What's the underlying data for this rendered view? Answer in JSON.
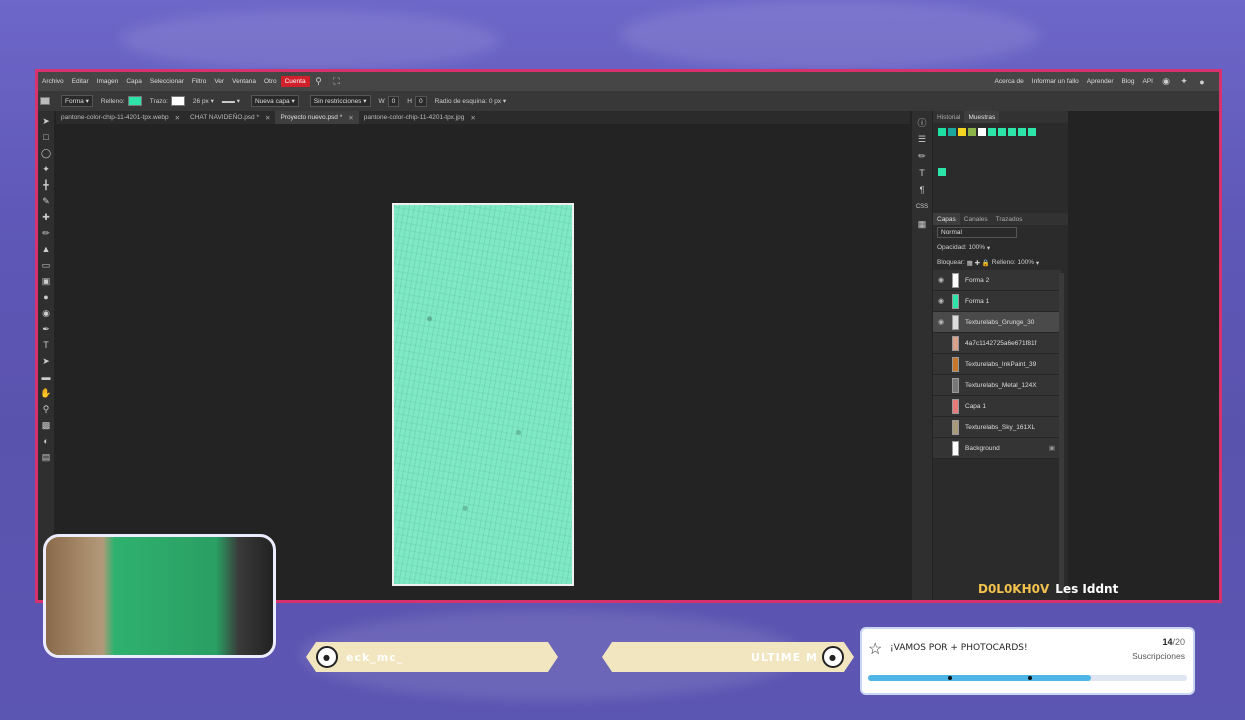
{
  "menubar": {
    "items": [
      "Archivo",
      "Editar",
      "Imagen",
      "Capa",
      "Seleccionar",
      "Filtro",
      "Ver",
      "Ventana",
      "Otro",
      "Cuenta"
    ],
    "right_links": [
      "Acerca de",
      "Informar un fallo",
      "Aprender",
      "Blog",
      "API"
    ]
  },
  "options": {
    "shape_mode": "Forma",
    "fill_label": "Relleno:",
    "fill_color": "#2de5a8",
    "stroke_label": "Trazo:",
    "stroke_size": "26 px",
    "layer_mode": "Nueva capa",
    "constraint": "Sin restricciones",
    "w": "0",
    "h": "0",
    "radius_label": "Radio de esquina:",
    "radius_value": "0 px"
  },
  "tabs": [
    {
      "label": "pantone-color-chip-11-4201-tpx.webp",
      "active": false
    },
    {
      "label": "CHAT NAVIDEÑO.psd *",
      "active": false
    },
    {
      "label": "Proyecto nuevo.psd *",
      "active": true
    },
    {
      "label": "pantone-color-chip-11-4201-tpx.jpg",
      "active": false
    }
  ],
  "right_panel": {
    "top_tabs": [
      "Historial",
      "Muestras"
    ],
    "swatches": [
      "#1de0a2",
      "#1aa7a0",
      "#f4d622",
      "#8bb34a",
      "#ffffff",
      "#2de5a8",
      "#2de5a8",
      "#2de5a8",
      "#2de5a8",
      "#2de5a8",
      "#2de5a8"
    ],
    "layer_tabs": [
      "Capas",
      "Canales",
      "Trazados"
    ],
    "blend_mode": "Normal",
    "opacity_label": "Opacidad:",
    "opacity_value": "100%",
    "lock_label": "Bloquear:",
    "fill_label": "Relleno:",
    "fill_value": "100%",
    "layers": [
      {
        "name": "Forma 2",
        "visible": true,
        "selected": false,
        "thumb": "#ffffff"
      },
      {
        "name": "Forma 1",
        "visible": true,
        "selected": false,
        "thumb": "#2de5a8"
      },
      {
        "name": "Texturelabs_Grunge_30",
        "visible": true,
        "selected": true,
        "thumb": "#dddddd"
      },
      {
        "name": "4a7c1142725a6e671f81f",
        "visible": false,
        "selected": false,
        "thumb": "#d9a08a"
      },
      {
        "name": "Texturelabs_InkPaint_39",
        "visible": false,
        "selected": false,
        "thumb": "#c8782a"
      },
      {
        "name": "Texturelabs_Metal_124X",
        "visible": false,
        "selected": false,
        "thumb": "#777777"
      },
      {
        "name": "Capa 1",
        "visible": false,
        "selected": false,
        "thumb": "#e77b7b"
      },
      {
        "name": "Texturelabs_Sky_161XL",
        "visible": false,
        "selected": false,
        "thumb": "#a89a7a"
      },
      {
        "name": "Background",
        "visible": false,
        "selected": false,
        "thumb": "#ffffff"
      }
    ]
  },
  "chat": {
    "user": "D0L0KH0V",
    "message": "Les Iddnt"
  },
  "banners": {
    "left": "eck_mc_",
    "right": "ULTIME M"
  },
  "goal": {
    "title": "¡VAMOS POR + PHOTOCARDS!",
    "current": "14",
    "total": "/20",
    "label": "Suscripciones",
    "progress": 0.7
  }
}
